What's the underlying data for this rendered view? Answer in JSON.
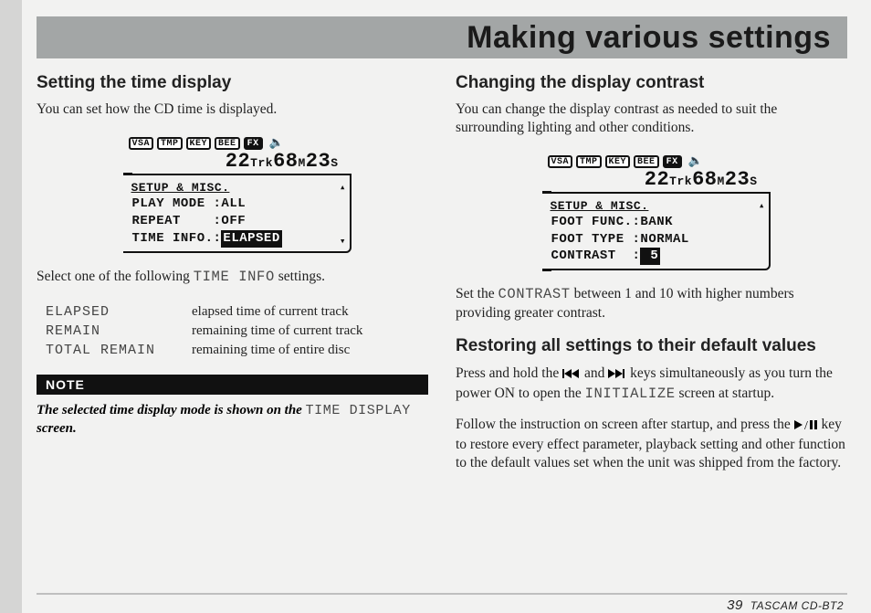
{
  "header": {
    "title": "Making various settings"
  },
  "left": {
    "heading": "Setting the time display",
    "intro": "You can set how the CD time is displayed.",
    "lcd": {
      "icons": [
        "VSA",
        "TMP",
        "KEY",
        "BEE",
        "FX"
      ],
      "track": "22",
      "trk_label": "Trk",
      "min": "68",
      "min_label": "M",
      "sec": "23",
      "sec_label": "S",
      "tab": "SETUP & MISC.",
      "rows": [
        {
          "label": "PLAY MODE :",
          "value": "ALL",
          "inv": false
        },
        {
          "label": "REPEAT    :",
          "value": "OFF",
          "inv": false
        },
        {
          "label": "TIME INFO.:",
          "value": "ELAPSED",
          "inv": true
        }
      ]
    },
    "after_lcd_pre": "Select one of the following ",
    "after_lcd_mono": "TIME INFO",
    "after_lcd_post": " settings.",
    "table": [
      {
        "key": "ELAPSED",
        "val": "elapsed time of current track"
      },
      {
        "key": "REMAIN",
        "val": "remaining time of current track"
      },
      {
        "key": "TOTAL REMAIN",
        "val": "remaining time of entire disc"
      }
    ],
    "note_label": "NOTE",
    "note_pre": "The selected time display mode is shown on the ",
    "note_mono": "TIME DISPLAY",
    "note_post": " screen."
  },
  "right": {
    "sec1_heading": "Changing the display contrast",
    "sec1_intro": "You can change the display contrast as needed to suit the surrounding lighting and other conditions.",
    "lcd": {
      "icons": [
        "VSA",
        "TMP",
        "KEY",
        "BEE",
        "FX"
      ],
      "track": "22",
      "trk_label": "Trk",
      "min": "68",
      "min_label": "M",
      "sec": "23",
      "sec_label": "S",
      "tab": "SETUP & MISC.",
      "rows": [
        {
          "label": "FOOT FUNC.:",
          "value": "BANK",
          "inv": false
        },
        {
          "label": "FOOT TYPE :",
          "value": "NORMAL",
          "inv": false
        },
        {
          "label": "CONTRAST  :",
          "value": " 5",
          "inv": true
        }
      ]
    },
    "sec1_after_pre": "Set the ",
    "sec1_after_mono": "CONTRAST",
    "sec1_after_post": " between 1 and 10 with higher numbers providing greater contrast.",
    "sec2_heading": "Restoring all settings to their default values",
    "sec2_p1_a": "Press and hold the ",
    "sec2_p1_b": " and ",
    "sec2_p1_c": " keys simultaneously as you turn the power ON to open the ",
    "sec2_p1_mono": "INITIALIZE",
    "sec2_p1_d": " screen at startup.",
    "sec2_p2_a": "Follow the instruction on screen after startup, and press the ",
    "sec2_p2_b": " key to restore every effect parameter, playback setting and other function to the default values set when the unit was shipped from the factory."
  },
  "footer": {
    "page": "39",
    "model": "TASCAM  CD-BT2"
  }
}
